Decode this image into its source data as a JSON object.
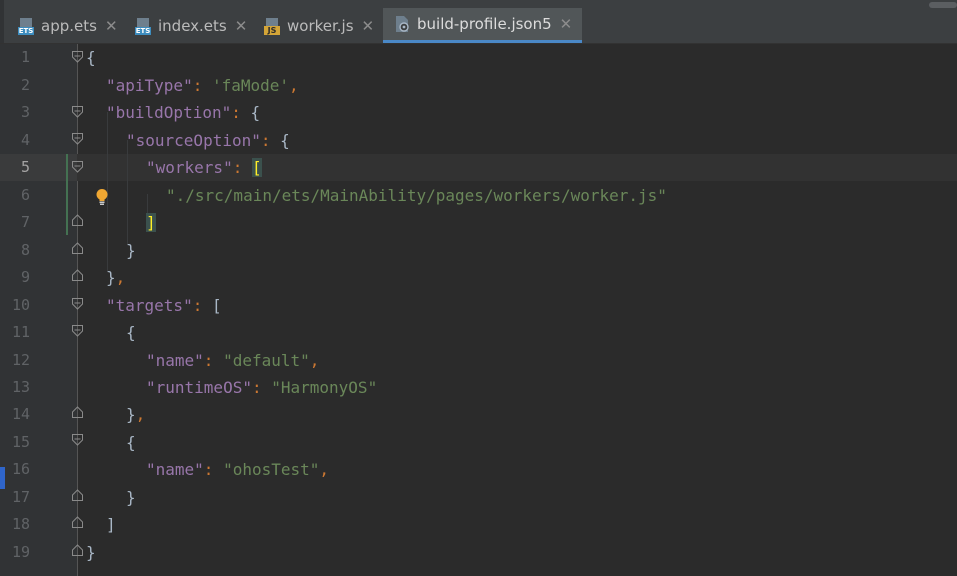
{
  "tabs": [
    {
      "name": "app.ets",
      "icon": "ets-file-icon",
      "active": false
    },
    {
      "name": "index.ets",
      "icon": "ets-file-icon",
      "active": false
    },
    {
      "name": "worker.js",
      "icon": "js-file-icon",
      "active": false
    },
    {
      "name": "build-profile.json5",
      "icon": "config-file-icon",
      "active": true
    }
  ],
  "tab_close_glyph": "✕",
  "editor": {
    "current_line": 5,
    "lines": [
      {
        "n": "1"
      },
      {
        "n": "2"
      },
      {
        "n": "3"
      },
      {
        "n": "4"
      },
      {
        "n": "5"
      },
      {
        "n": "6"
      },
      {
        "n": "7"
      },
      {
        "n": "8"
      },
      {
        "n": "9"
      },
      {
        "n": "10"
      },
      {
        "n": "11"
      },
      {
        "n": "12"
      },
      {
        "n": "13"
      },
      {
        "n": "14"
      },
      {
        "n": "15"
      },
      {
        "n": "16"
      },
      {
        "n": "17"
      },
      {
        "n": "18"
      },
      {
        "n": "19"
      }
    ],
    "code": {
      "l1": {
        "brace": "{"
      },
      "l2": {
        "key": "\"apiType\"",
        "colon": ": ",
        "value": "'faMode'",
        "comma": ","
      },
      "l3": {
        "key": "\"buildOption\"",
        "colon": ": ",
        "brace": "{"
      },
      "l4": {
        "key": "\"sourceOption\"",
        "colon": ": ",
        "brace": "{"
      },
      "l5": {
        "key": "\"workers\"",
        "colon": ": ",
        "bracket": "["
      },
      "l6": {
        "value": "\"./src/main/ets/MainAbility/pages/workers/worker.js\""
      },
      "l7": {
        "bracket": "]"
      },
      "l8": {
        "brace": "}"
      },
      "l9": {
        "brace": "}",
        "comma": ","
      },
      "l10": {
        "key": "\"targets\"",
        "colon": ": ",
        "bracket": "["
      },
      "l11": {
        "brace": "{"
      },
      "l12": {
        "key": "\"name\"",
        "colon": ": ",
        "value": "\"default\"",
        "comma": ","
      },
      "l13": {
        "key": "\"runtimeOS\"",
        "colon": ": ",
        "value": "\"HarmonyOS\""
      },
      "l14": {
        "brace": "}",
        "comma": ","
      },
      "l15": {
        "brace": "{"
      },
      "l16": {
        "key": "\"name\"",
        "colon": ": ",
        "value": "\"ohosTest\"",
        "comma": ","
      },
      "l17": {
        "brace": "}"
      },
      "l18": {
        "bracket": "]"
      },
      "l19": {
        "brace": "}"
      }
    }
  },
  "colors": {
    "key": "#9876aa",
    "string": "#6a8759",
    "punctuation": "#cc7832",
    "text": "#a9b7c6",
    "bracket_match": "#ffef28",
    "tab_active_underline": "#4a88c7",
    "bulb": "#f0a732"
  }
}
